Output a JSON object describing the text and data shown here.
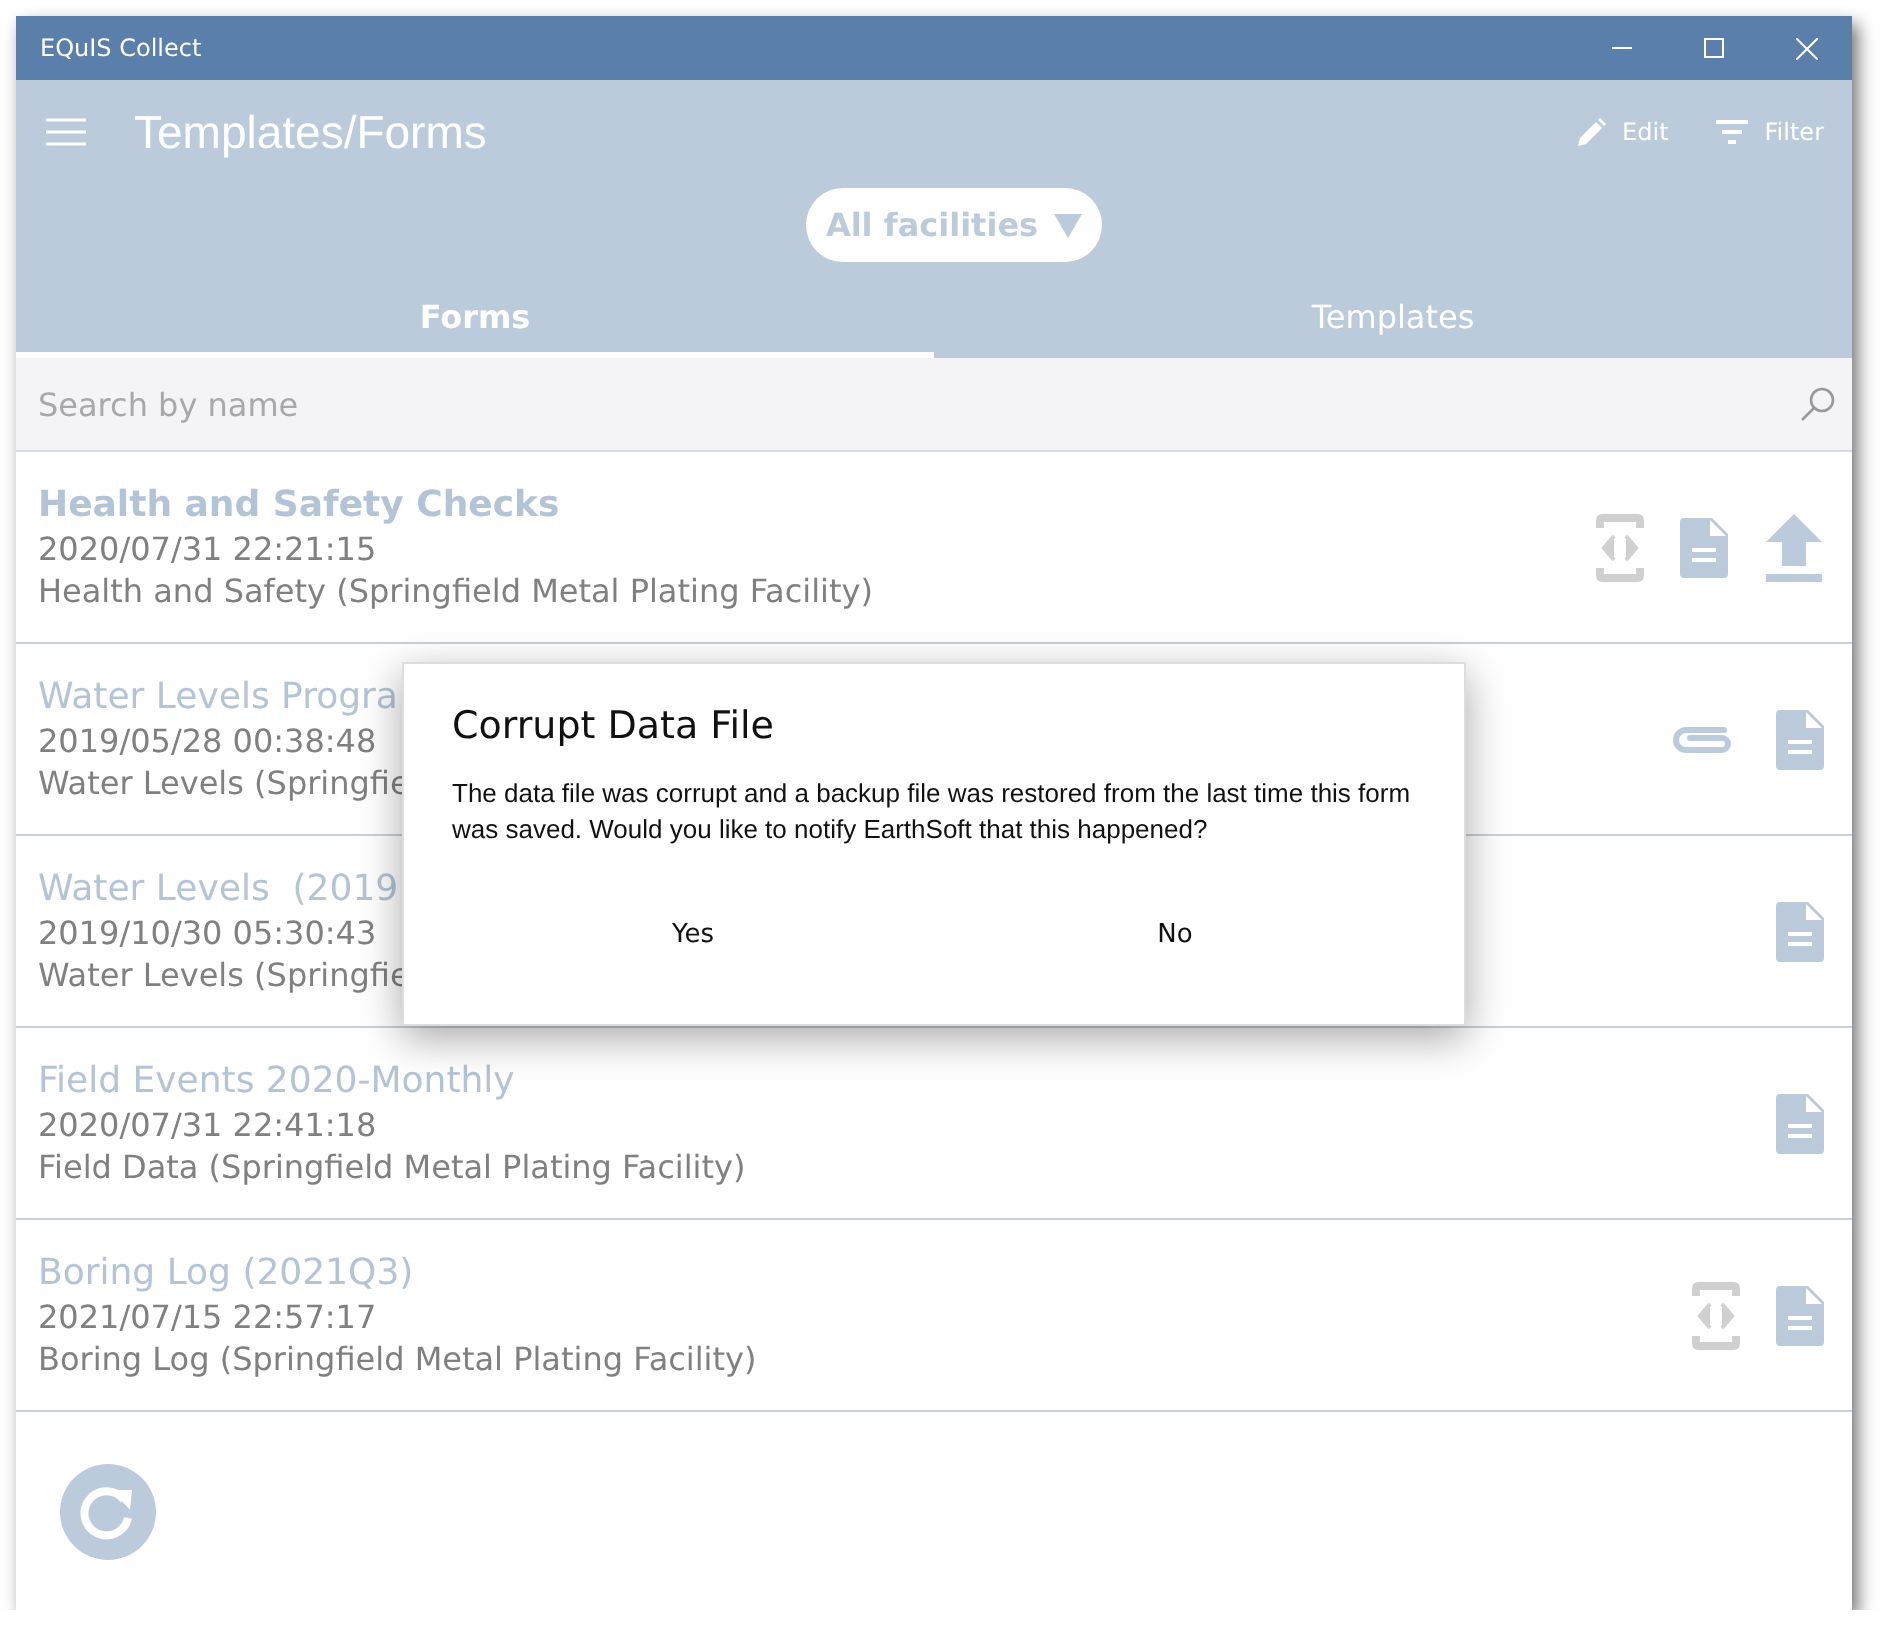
{
  "window": {
    "title": "EQuIS Collect"
  },
  "header": {
    "title": "Templates/Forms",
    "actions": [
      {
        "kind": "edit",
        "label": "Edit"
      },
      {
        "kind": "filter",
        "label": "Filter"
      }
    ]
  },
  "facility_picker": {
    "value": "All facilities"
  },
  "tabs": [
    {
      "label": "Forms",
      "selected": true
    },
    {
      "label": "Templates",
      "selected": false
    }
  ],
  "search": {
    "placeholder": "Search by name"
  },
  "forms": [
    {
      "title": "Health and Safety Checks",
      "highlighted": true,
      "date": "2020/07/31 22:21:15",
      "subtitle": "Health and Safety (Springfield Metal Plating Facility)",
      "icons": [
        {
          "kind": "code"
        },
        {
          "kind": "document"
        },
        {
          "kind": "upload"
        }
      ]
    },
    {
      "title": "Water Levels Progra",
      "highlighted": false,
      "date": "2019/05/28 00:38:48",
      "subtitle": "Water Levels (Springfie",
      "icons": [
        {
          "kind": "attachment"
        },
        {
          "kind": "document"
        }
      ]
    },
    {
      "title": "Water Levels  (2019",
      "highlighted": false,
      "date": "2019/10/30 05:30:43",
      "subtitle": "Water Levels (Springfie",
      "icons": [
        {
          "kind": "document"
        }
      ]
    },
    {
      "title": "Field Events 2020-Monthly",
      "highlighted": false,
      "date": "2020/07/31 22:41:18",
      "subtitle": "Field Data (Springfield Metal Plating Facility)",
      "icons": [
        {
          "kind": "document"
        }
      ]
    },
    {
      "title": "Boring Log (2021Q3)",
      "highlighted": false,
      "date": "2021/07/15 22:57:17",
      "subtitle": "Boring Log (Springfield Metal Plating Facility)",
      "icons": [
        {
          "kind": "code"
        },
        {
          "kind": "document"
        }
      ]
    }
  ],
  "dialog": {
    "title": "Corrupt Data File",
    "message": "The data file was corrupt and a backup file was restored from the last time this form was saved. Would you like to notify EarthSoft that this happened?",
    "buttons": [
      "Yes",
      "No"
    ]
  }
}
